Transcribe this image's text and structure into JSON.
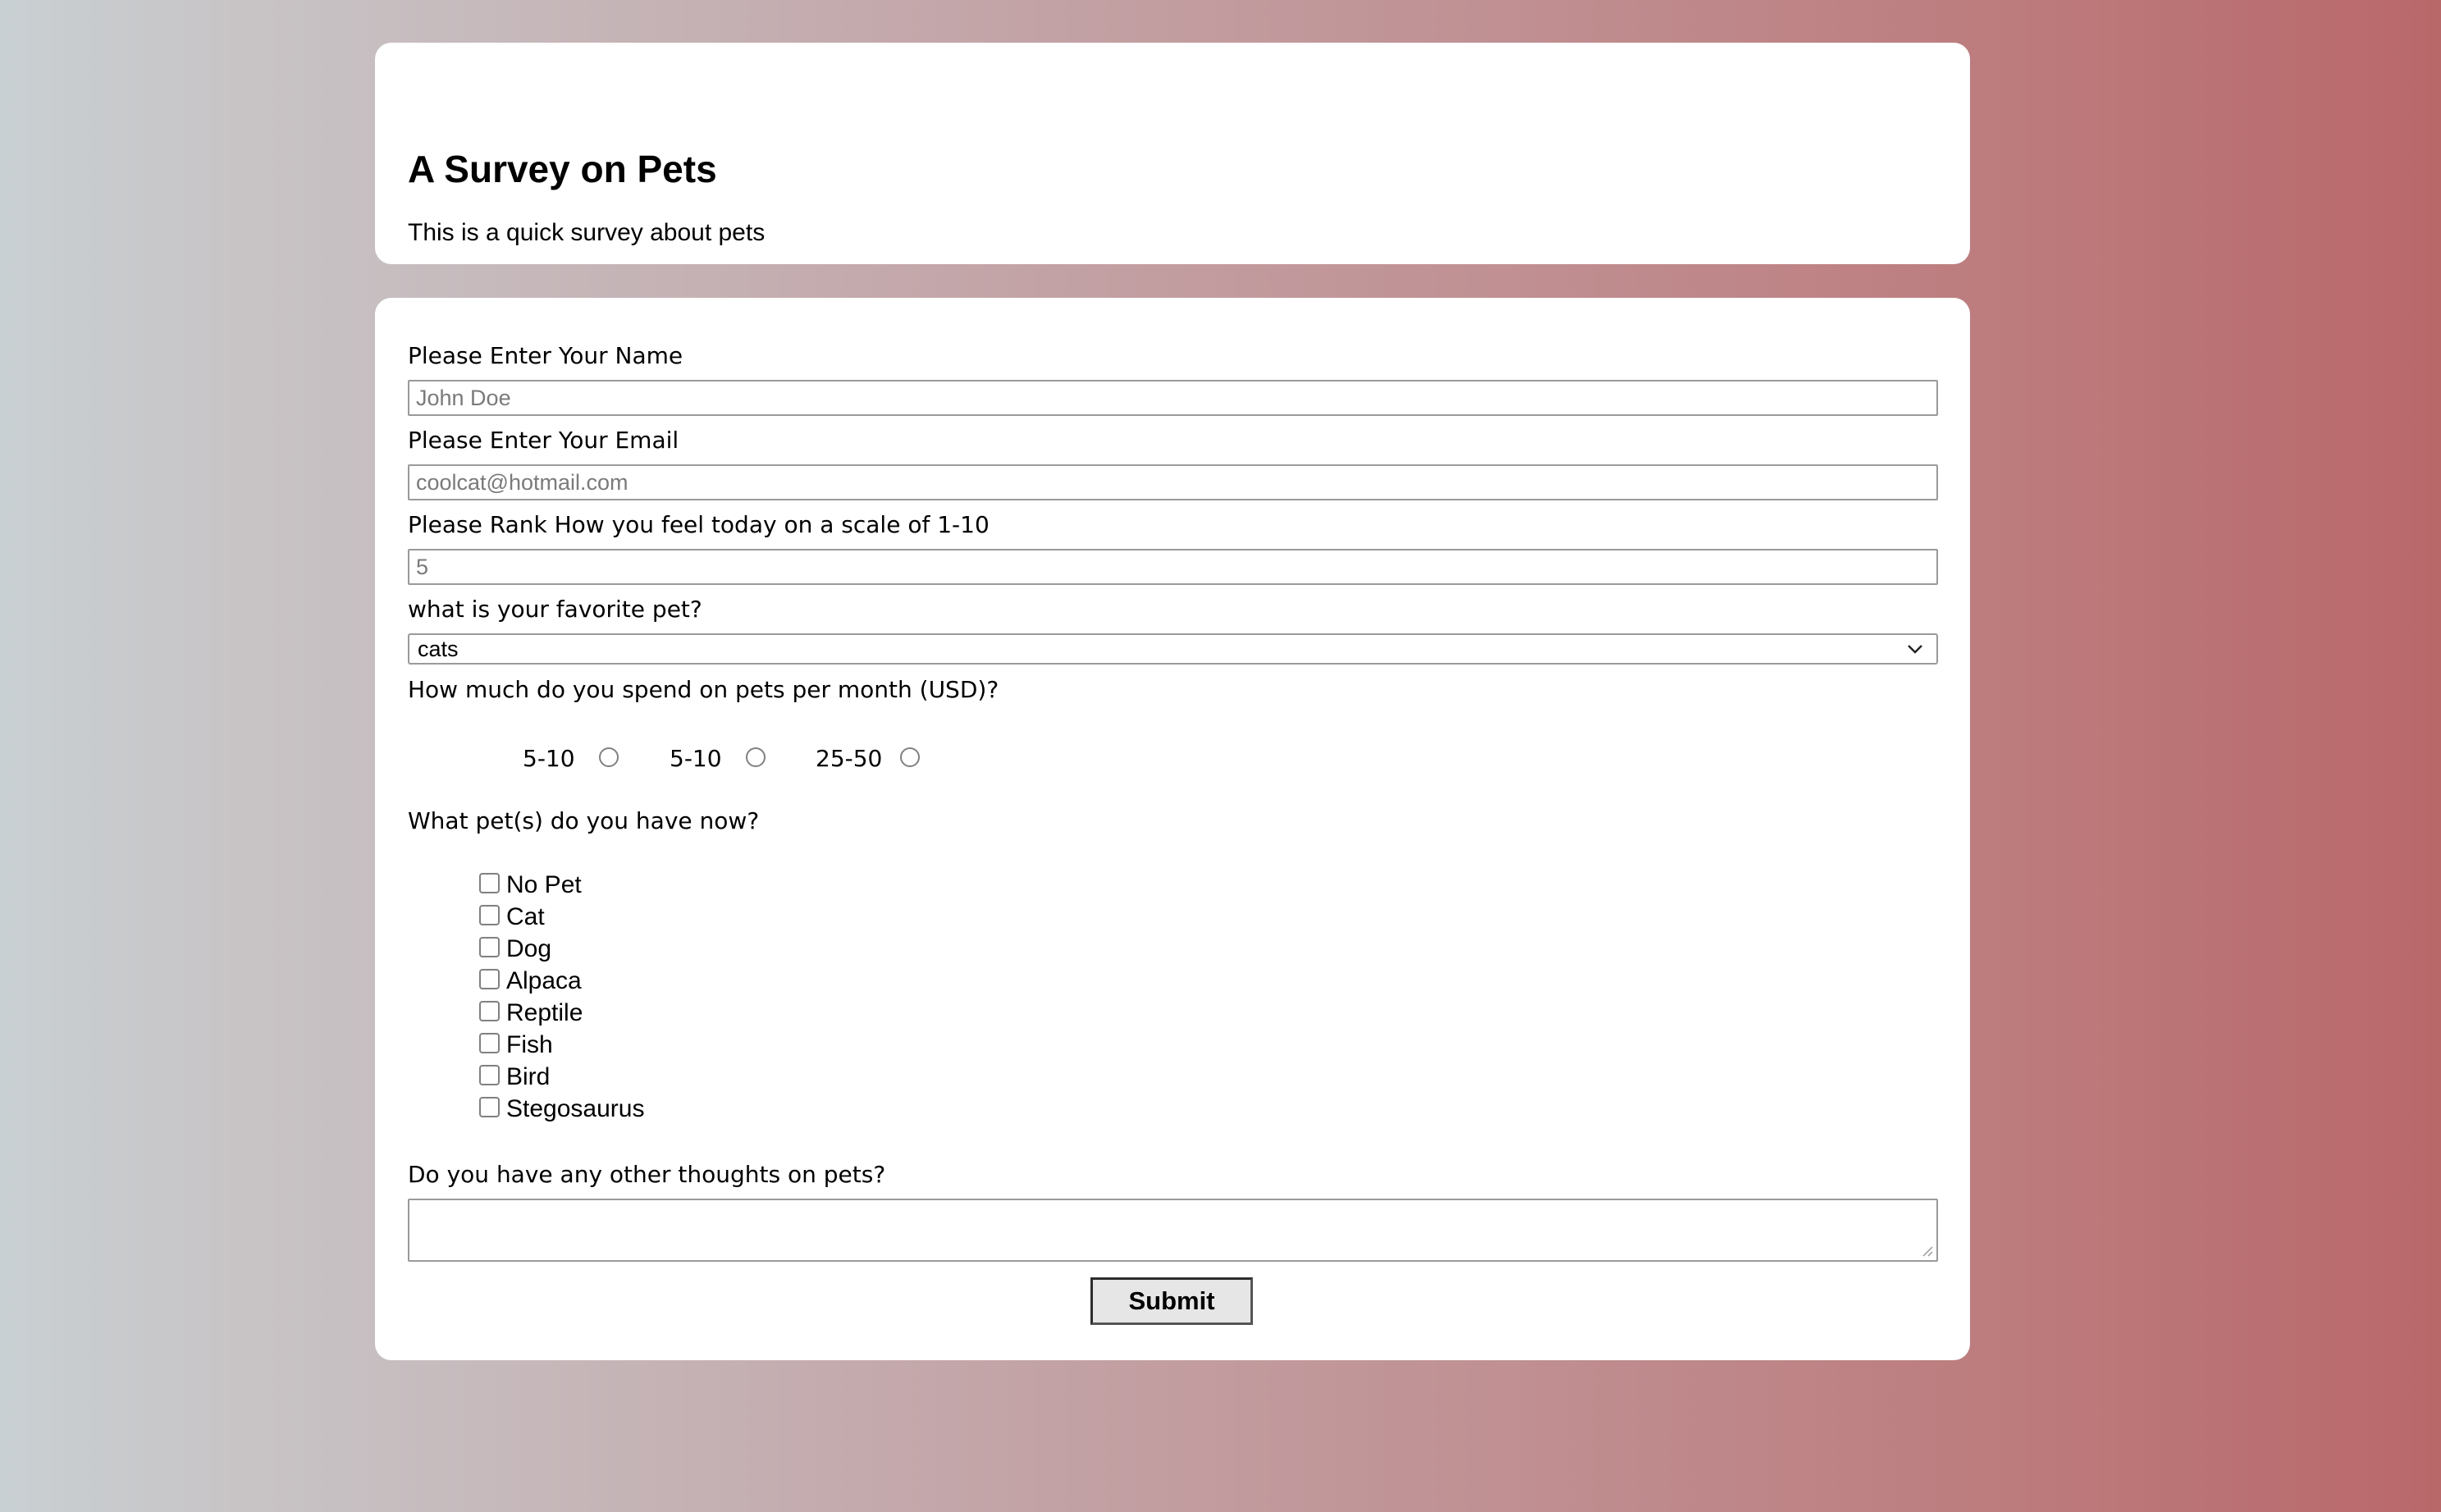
{
  "header": {
    "title": "A Survey on Pets",
    "description": "This is a quick survey about pets"
  },
  "form": {
    "name": {
      "label": "Please Enter Your Name",
      "placeholder": "John Doe"
    },
    "email": {
      "label": "Please Enter Your Email",
      "placeholder": "coolcat@hotmail.com"
    },
    "rank": {
      "label": "Please Rank How you feel today on a scale of 1-10",
      "placeholder": "5"
    },
    "favorite_pet": {
      "label": "what is your favorite pet?",
      "selected": "cats",
      "icon": "chevron-down-icon"
    },
    "spend": {
      "label": "How much do you spend on pets per month (USD)?",
      "options": [
        "5-10",
        "5-10",
        "25-50"
      ]
    },
    "pets_owned": {
      "label": "What pet(s) do you have now?",
      "options": [
        "No Pet",
        "Cat",
        "Dog",
        "Alpaca",
        "Reptile",
        "Fish",
        "Bird",
        "Stegosaurus"
      ]
    },
    "thoughts": {
      "label": "Do you have any other thoughts on pets?"
    },
    "submit_label": "Submit"
  }
}
